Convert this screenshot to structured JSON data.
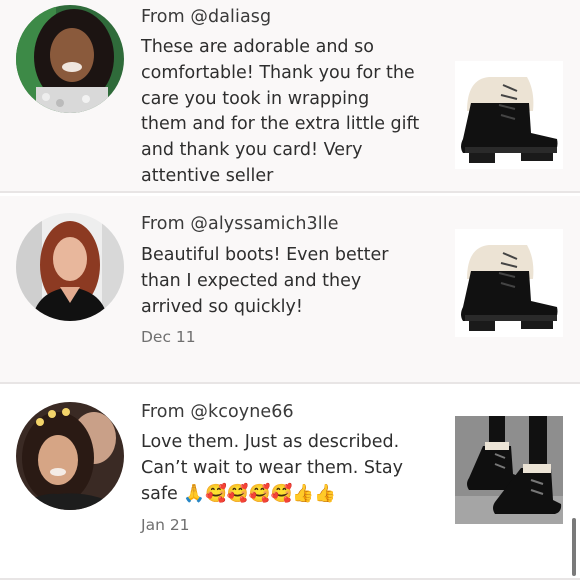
{
  "reviews": [
    {
      "from": "From @daliasg",
      "lines": [
        "These are adorable and so",
        "comfortable! Thank you for the",
        "care you took in wrapping",
        "them and for the extra little gift",
        "and thank you card! Very",
        "attentive seller"
      ],
      "date": ""
    },
    {
      "from": "From @alyssamich3lle",
      "lines": [
        "Beautiful boots! Even better",
        "than I expected and they",
        "arrived so quickly!"
      ],
      "date": "Dec 11"
    },
    {
      "from": "From @kcoyne66",
      "lines": [
        "Love them. Just as described.",
        "Can’t wait to wear them. Stay",
        "safe 🙏🥰🥰🥰🥰👍👍"
      ],
      "date": "Jan 21"
    }
  ],
  "icons": {
    "avatar": "avatar-photo",
    "product": "boot-product-photo"
  }
}
